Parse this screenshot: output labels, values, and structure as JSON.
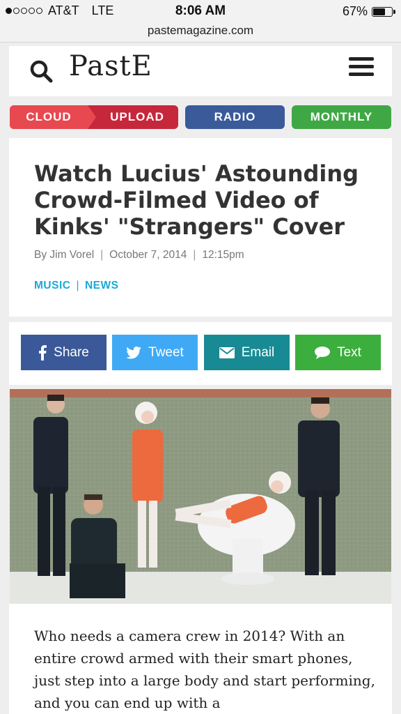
{
  "status_bar": {
    "carrier": "AT&T",
    "network": "LTE",
    "time": "8:06 AM",
    "battery": "67%",
    "battery_level": 0.67
  },
  "url": "pastemagazine.com",
  "header": {
    "logo": "PastE",
    "search_icon": "search-icon",
    "menu_icon": "hamburger-menu-icon"
  },
  "nav": {
    "cloud": "CLOUD",
    "upload": "UPLOAD",
    "radio": "RADIO",
    "monthly": "MONTHLY"
  },
  "article": {
    "headline": "Watch Lucius' Astounding Crowd-Filmed Video of Kinks' \"Strangers\" Cover",
    "author": "By Jim Vorel",
    "date": "October 7, 2014",
    "time": "12:15pm",
    "tags": [
      "MUSIC",
      "NEWS"
    ],
    "body": "Who needs a camera crew in 2014? With an entire crowd armed with their smart phones, just step into a large body and start performing, and you can end up with a"
  },
  "share": {
    "facebook": "Share",
    "twitter": "Tweet",
    "email": "Email",
    "text": "Text"
  },
  "colors": {
    "cloud": "#e8484f",
    "upload": "#c6273b",
    "radio": "#3a5a9a",
    "monthly": "#3fa845",
    "facebook": "#3b5998",
    "twitter": "#3fa9f5",
    "email": "#188a93",
    "text": "#3cae3d",
    "tag": "#19a9d8"
  }
}
